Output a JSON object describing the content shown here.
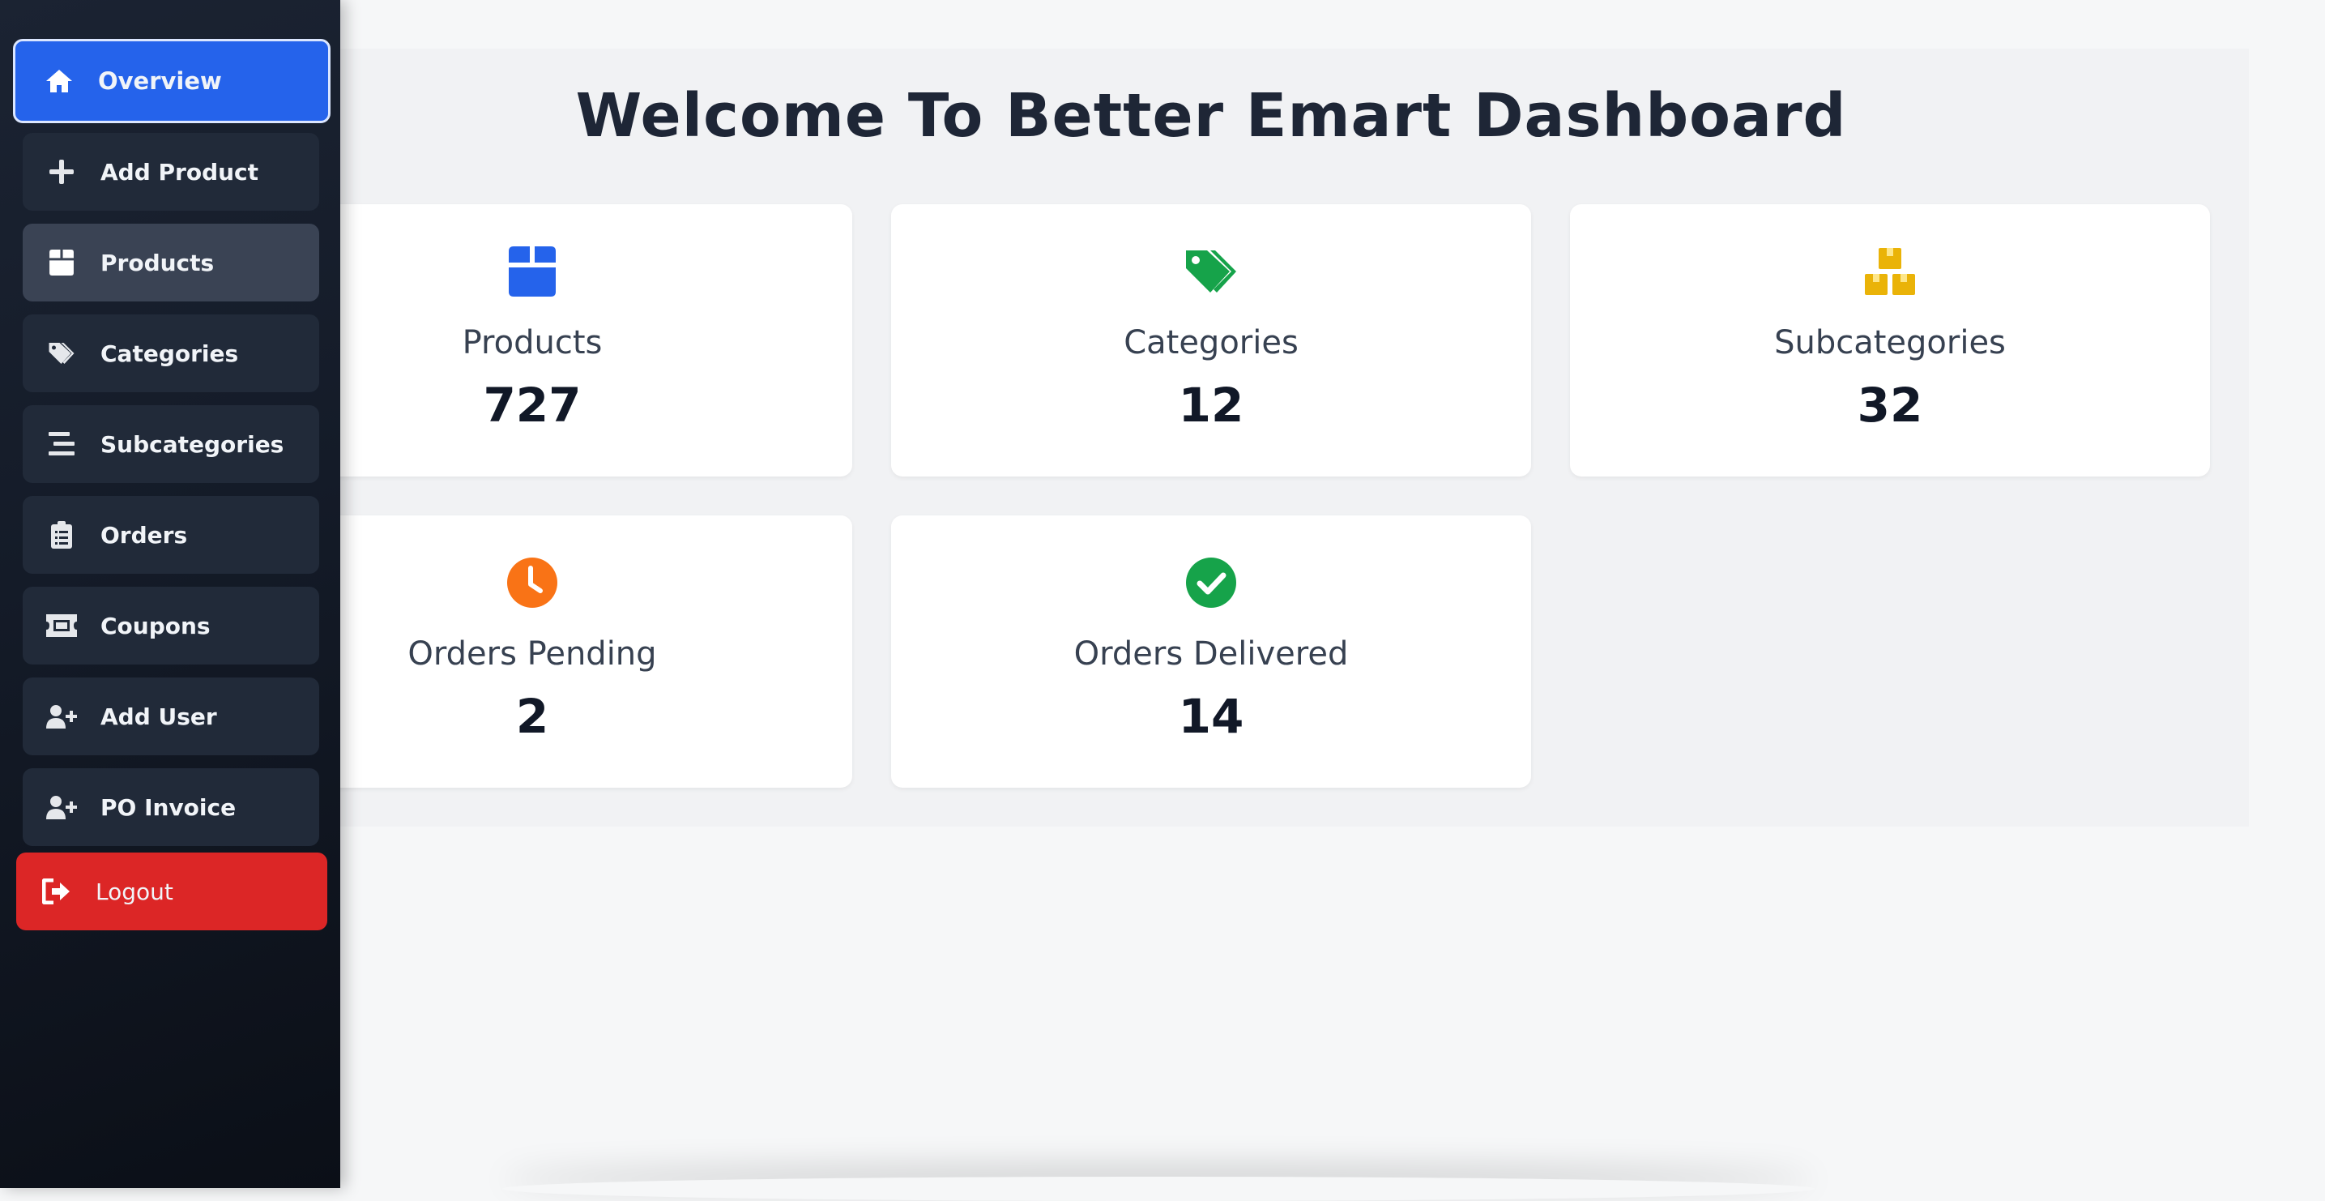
{
  "dashboard": {
    "title": "Welcome To Better Emart Dashboard",
    "cards": [
      {
        "label": "Products",
        "value": "727",
        "icon": "box-icon",
        "color": "#2563eb"
      },
      {
        "label": "Categories",
        "value": "12",
        "icon": "tags-icon",
        "color": "#16a34a"
      },
      {
        "label": "Subcategories",
        "value": "32",
        "icon": "boxes-icon",
        "color": "#eab308"
      },
      {
        "label": "Orders Pending",
        "value": "2",
        "icon": "clock-icon",
        "color": "#f97316"
      },
      {
        "label": "Orders Delivered",
        "value": "14",
        "icon": "check-circle-icon",
        "color": "#16a34a"
      }
    ]
  },
  "sidebar": {
    "items": [
      {
        "label": "Overview",
        "icon": "home-icon",
        "state": "active"
      },
      {
        "label": "Add Product",
        "icon": "plus-icon"
      },
      {
        "label": "Products",
        "icon": "box-icon",
        "state": "hovered"
      },
      {
        "label": "Categories",
        "icon": "tags-icon"
      },
      {
        "label": "Subcategories",
        "icon": "list-icon"
      },
      {
        "label": "Orders",
        "icon": "clipboard-icon"
      },
      {
        "label": "Coupons",
        "icon": "ticket-icon"
      },
      {
        "label": "Add User",
        "icon": "user-plus-icon"
      },
      {
        "label": "PO Invoice",
        "icon": "user-plus-icon"
      }
    ],
    "logout": {
      "label": "Logout",
      "icon": "sign-out-icon"
    }
  },
  "colors": {
    "active": "#2563eb",
    "logout": "#dc2626",
    "sidebar": "#141b28"
  }
}
